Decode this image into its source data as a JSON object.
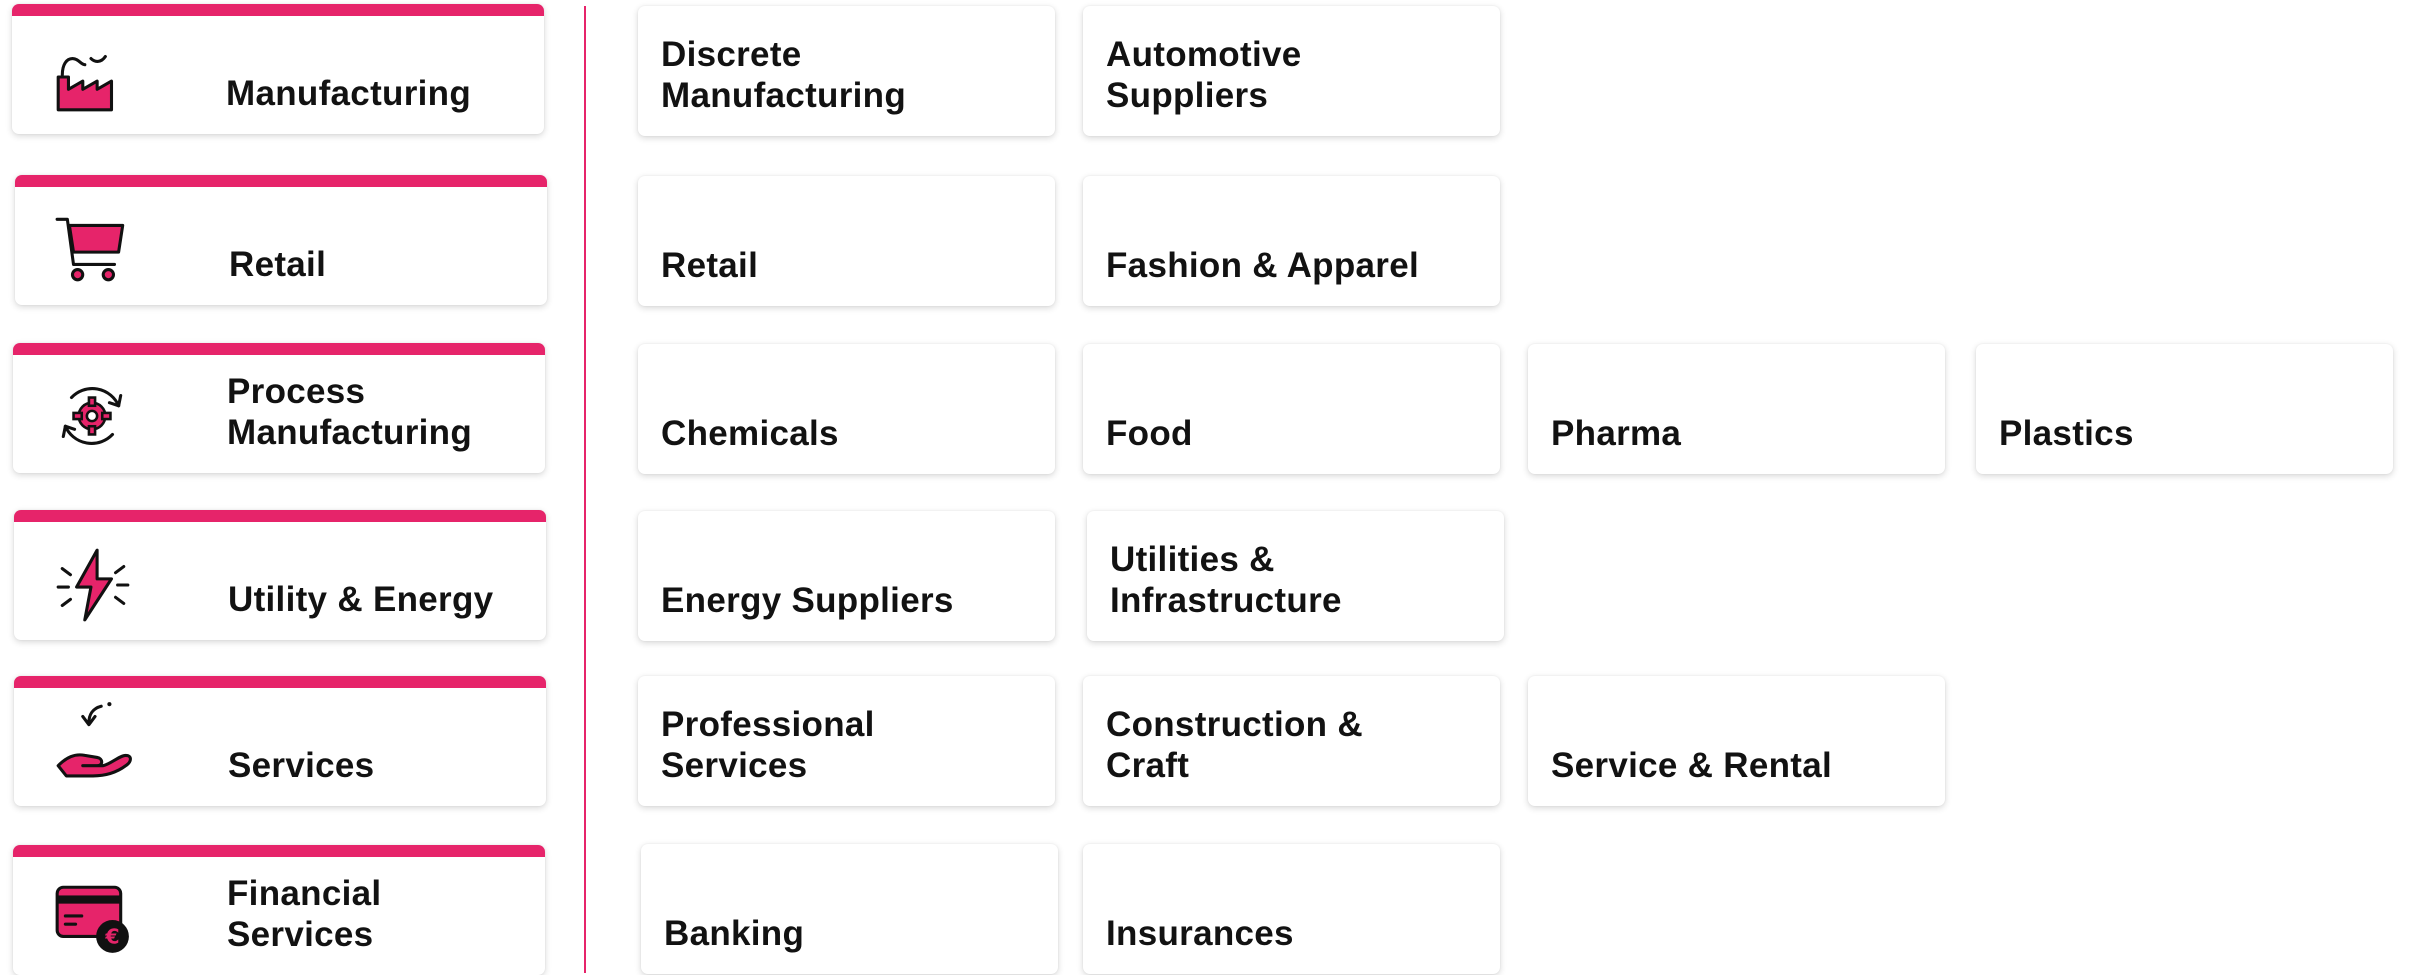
{
  "accent_color": "#e6246a",
  "categories": [
    {
      "label": "Manufacturing",
      "icon": "factory-icon"
    },
    {
      "label": "Retail",
      "icon": "shopping-cart-icon"
    },
    {
      "label": "Process\nManufacturing",
      "icon": "gear-cycle-icon"
    },
    {
      "label": "Utility & Energy",
      "icon": "lightning-bolt-icon"
    },
    {
      "label": "Services",
      "icon": "hand-service-icon"
    },
    {
      "label": "Financial\nServices",
      "icon": "card-euro-icon"
    }
  ],
  "subcategories": [
    [
      "Discrete\nManufacturing",
      "Automotive\nSuppliers"
    ],
    [
      "Retail",
      "Fashion & Apparel"
    ],
    [
      "Chemicals",
      "Food",
      "Pharma",
      "Plastics"
    ],
    [
      "Energy Suppliers",
      "Utilities &\nInfrastructure"
    ],
    [
      "Professional\nServices",
      "Construction &\nCraft",
      "Service & Rental"
    ],
    [
      "Banking",
      "Insurances"
    ]
  ]
}
